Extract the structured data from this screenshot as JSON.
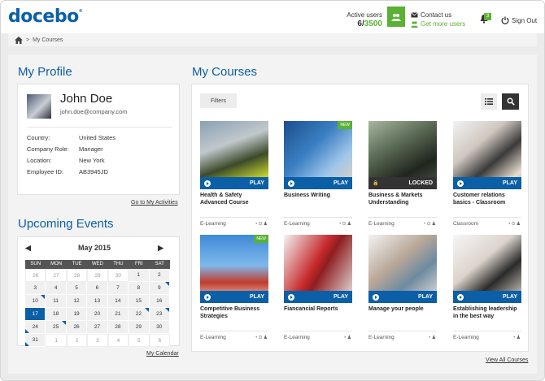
{
  "brand": {
    "logo": "docebo",
    "trademark": "®"
  },
  "header": {
    "active_users_label": "Active users",
    "active_users_current": "6",
    "active_users_separator": "/",
    "active_users_max": "3500",
    "contact_us": "Contact us",
    "get_more_users": "Get more users",
    "notifications_count": "3",
    "sign_out": "Sign Out"
  },
  "breadcrumb": {
    "current": "My Courses",
    "separator": ">"
  },
  "profile": {
    "section_title": "My Profile",
    "name": "John Doe",
    "email": "john.doe@company.com",
    "fields": [
      {
        "label": "Country:",
        "value": "United States"
      },
      {
        "label": "Company Role:",
        "value": "Manager"
      },
      {
        "label": "Location:",
        "value": "New York"
      },
      {
        "label": "Employee ID:",
        "value": "AB3945JD"
      }
    ],
    "activities_link": "Go to My Activities"
  },
  "events": {
    "section_title": "Upcoming Events",
    "month": "May 2015",
    "weekdays": [
      "SUN",
      "MON",
      "TUE",
      "WED",
      "THU",
      "FRI",
      "SAT"
    ],
    "days": [
      {
        "d": "26",
        "out": true
      },
      {
        "d": "27",
        "out": true
      },
      {
        "d": "28",
        "out": true
      },
      {
        "d": "29",
        "out": true
      },
      {
        "d": "30",
        "out": true
      },
      {
        "d": "1"
      },
      {
        "d": "2"
      },
      {
        "d": "3"
      },
      {
        "d": "4"
      },
      {
        "d": "5"
      },
      {
        "d": "6"
      },
      {
        "d": "7"
      },
      {
        "d": "8"
      },
      {
        "d": "9"
      },
      {
        "d": "10"
      },
      {
        "d": "11"
      },
      {
        "d": "12"
      },
      {
        "d": "13"
      },
      {
        "d": "14"
      },
      {
        "d": "15"
      },
      {
        "d": "16"
      },
      {
        "d": "17"
      },
      {
        "d": "18"
      },
      {
        "d": "19"
      },
      {
        "d": "20"
      },
      {
        "d": "21"
      },
      {
        "d": "22"
      },
      {
        "d": "23"
      },
      {
        "d": "24"
      },
      {
        "d": "25"
      },
      {
        "d": "26"
      },
      {
        "d": "27"
      },
      {
        "d": "28"
      },
      {
        "d": "29"
      },
      {
        "d": "30"
      },
      {
        "d": "31"
      },
      {
        "d": "1",
        "out": true
      },
      {
        "d": "2",
        "out": true
      },
      {
        "d": "3",
        "out": true
      },
      {
        "d": "4",
        "out": true
      },
      {
        "d": "5",
        "out": true
      },
      {
        "d": "6",
        "out": true
      }
    ],
    "calendar_link": "My Calendar",
    "prev_icon": "chevron-left-icon",
    "next_icon": "chevron-right-icon"
  },
  "courses": {
    "section_title": "My Courses",
    "filters_label": "Filters",
    "view_all": "View All Courses",
    "items": [
      {
        "title": "Health & Safety Advanced Course",
        "action": "PLAY",
        "type": "E-Learning",
        "icons": "◔⊙♟",
        "badge": "",
        "locked": false
      },
      {
        "title": "Business Writing",
        "action": "PLAY",
        "type": "E-Learning",
        "icons": "◔⊙♟",
        "badge": "NEW",
        "locked": false
      },
      {
        "title": "Business & Markets Understanding",
        "action": "LOCKED",
        "type": "E-Learning",
        "icons": "◔⊙♟",
        "badge": "",
        "locked": true
      },
      {
        "title": "Customer relations basics - Classroom",
        "action": "PLAY",
        "type": "Classroom",
        "icons": "◔⊙♟",
        "badge": "",
        "locked": false
      },
      {
        "title": "Competitive Business Strategies",
        "action": "PLAY",
        "type": "E-Learning",
        "icons": "◔⊙♟",
        "badge": "NEW",
        "locked": false
      },
      {
        "title": "Fiancancial Reports",
        "action": "PLAY",
        "type": "E-Learning",
        "icons": "◔♟",
        "badge": "",
        "locked": false
      },
      {
        "title": "Manage your people",
        "action": "PLAY",
        "type": "E-Learning",
        "icons": "◔♟",
        "badge": "",
        "locked": false
      },
      {
        "title": "Establishing leadership in the best way",
        "action": "PLAY",
        "type": "E-Learning",
        "icons": "◔♟",
        "badge": "",
        "locked": false
      }
    ]
  },
  "colors": {
    "brand_blue": "#0b5fa7",
    "accent_green": "#5ab133",
    "dark": "#333333"
  }
}
